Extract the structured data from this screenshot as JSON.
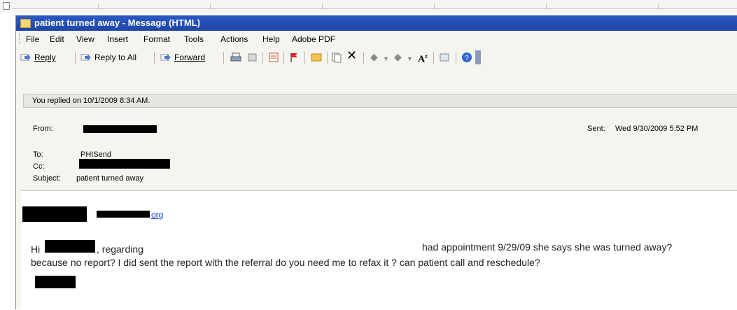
{
  "window": {
    "title": "patient turned away - Message (HTML)"
  },
  "menu": {
    "items": [
      "File",
      "Edit",
      "View",
      "Insert",
      "Format",
      "Tools",
      "Actions",
      "Help",
      "Adobe PDF"
    ]
  },
  "toolbar": {
    "reply_label": "Reply",
    "reply_all_label": "Reply to All",
    "forward_label": "Forward"
  },
  "notice": {
    "text": "You replied on 10/1/2009 8:34 AM."
  },
  "header": {
    "from_label": "From:",
    "to_label": "To:",
    "to_value": "PHISend",
    "cc_label": "Cc:",
    "subject_label": "Subject:",
    "subject_value": "patient turned away",
    "sent_label": "Sent:",
    "sent_value": "Wed 9/30/2009 5:52 PM"
  },
  "body": {
    "email_link_suffix": "org",
    "line1_prefix": "Hi",
    "line1_part2": ", regarding",
    "line1_part3": "had appointment 9/29/09 she says she was turned away?",
    "line2": "because no report? I did sent the report with the referral do you need me to refax it ? can patient call and reschedule?"
  }
}
